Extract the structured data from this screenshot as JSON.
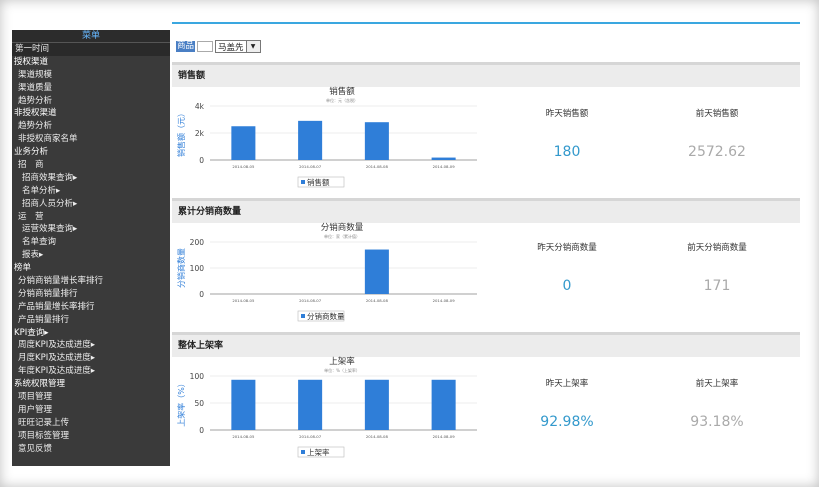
{
  "sidebar": {
    "title": "菜单",
    "items": [
      {
        "label": "第一时间",
        "level": "first"
      },
      {
        "label": "授权渠道",
        "level": "section"
      },
      {
        "label": "渠道规模",
        "level": "sub"
      },
      {
        "label": "渠道质量",
        "level": "sub"
      },
      {
        "label": "趋势分析",
        "level": "sub"
      },
      {
        "label": "非授权渠道",
        "level": "section"
      },
      {
        "label": "趋势分析",
        "level": "sub"
      },
      {
        "label": "非授权商家名单",
        "level": "sub"
      },
      {
        "label": "业务分析",
        "level": "section"
      },
      {
        "label": "招　商",
        "level": "sub"
      },
      {
        "label": "招商效果查询▸",
        "level": "sub2"
      },
      {
        "label": "名单分析▸",
        "level": "sub2"
      },
      {
        "label": "招商人员分析▸",
        "level": "sub2"
      },
      {
        "label": "运　营",
        "level": "sub"
      },
      {
        "label": "运营效果查询▸",
        "level": "sub2"
      },
      {
        "label": "名单查询",
        "level": "sub2"
      },
      {
        "label": "报表▸",
        "level": "sub2"
      },
      {
        "label": "榜单",
        "level": "section"
      },
      {
        "label": "分销商销量增长率排行",
        "level": "sub"
      },
      {
        "label": "分销商销量排行",
        "level": "sub"
      },
      {
        "label": "产品销量增长率排行",
        "level": "sub"
      },
      {
        "label": "产品销量排行",
        "level": "sub"
      },
      {
        "label": "KPI查询▸",
        "level": "section"
      },
      {
        "label": "周度KPI及达成进度▸",
        "level": "sub"
      },
      {
        "label": "月度KPI及达成进度▸",
        "level": "sub"
      },
      {
        "label": "年度KPI及达成进度▸",
        "level": "sub"
      },
      {
        "label": "系统权限管理",
        "level": "section"
      },
      {
        "label": "项目管理",
        "level": "sub"
      },
      {
        "label": "用户管理",
        "level": "sub"
      },
      {
        "label": "旺旺记录上传",
        "level": "sub"
      },
      {
        "label": "项目标签管理",
        "level": "sub"
      },
      {
        "label": "意见反馈",
        "level": "sub"
      }
    ]
  },
  "toolbar": {
    "label": "商品",
    "select_value": "马盖先",
    "arrow": "▼"
  },
  "panels": [
    {
      "title": "销售额",
      "chart_title": "销售额",
      "chart_subtitle": "单位：元（含税）",
      "ylabel": "销售额（元）",
      "legend": "销售额",
      "y_ticks": [
        "4k",
        "2k",
        "0"
      ],
      "stat_left_label": "昨天销售额",
      "stat_left_value": "180",
      "stat_right_label": "前天销售额",
      "stat_right_value": "2572.62"
    },
    {
      "title": "累计分销商数量",
      "chart_title": "分销商数量",
      "chart_subtitle": "单位：家（累计值）",
      "ylabel": "分销商数量",
      "legend": "分销商数量",
      "y_ticks": [
        "200",
        "100",
        "0"
      ],
      "stat_left_label": "昨天分销商数量",
      "stat_left_value": "0",
      "stat_right_label": "前天分销商数量",
      "stat_right_value": "171"
    },
    {
      "title": "整体上架率",
      "chart_title": "上架率",
      "chart_subtitle": "单位：%（上架率）",
      "ylabel": "上架率（%）",
      "legend": "上架率",
      "y_ticks": [
        "100",
        "50",
        "0"
      ],
      "stat_left_label": "昨天上架率",
      "stat_left_value": "92.98%",
      "stat_right_label": "前天上架率",
      "stat_right_value": "93.18%"
    }
  ],
  "chart_data": [
    {
      "type": "bar",
      "title": "销售额",
      "ylabel": "销售额（元）",
      "categories": [
        "2014-08-05",
        "2014-08-07",
        "2014-08-08",
        "2014-08-09"
      ],
      "series": [
        {
          "name": "销售额",
          "values": [
            2500,
            2900,
            2800,
            180
          ]
        }
      ],
      "ylim": [
        0,
        4000
      ],
      "color": "#2f7ed8"
    },
    {
      "type": "bar",
      "title": "分销商数量",
      "ylabel": "分销商数量",
      "categories": [
        "2014-08-05",
        "2014-08-07",
        "2014-08-08",
        "2014-08-09"
      ],
      "series": [
        {
          "name": "分销商数量",
          "values": [
            0,
            0,
            171,
            0
          ]
        }
      ],
      "ylim": [
        0,
        200
      ],
      "color": "#2f7ed8"
    },
    {
      "type": "bar",
      "title": "上架率",
      "ylabel": "上架率（%）",
      "categories": [
        "2014-08-05",
        "2014-08-07",
        "2014-08-08",
        "2014-08-09"
      ],
      "series": [
        {
          "name": "上架率",
          "values": [
            93,
            93,
            93,
            93
          ]
        }
      ],
      "ylim": [
        0,
        100
      ],
      "color": "#2f7ed8"
    }
  ]
}
